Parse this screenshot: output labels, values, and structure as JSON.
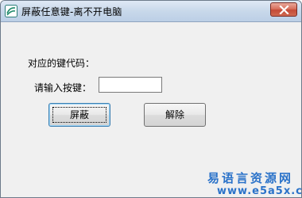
{
  "window": {
    "title": "屏蔽任意键-离不开电脑",
    "icon": "app-logo-icon",
    "close_icon": "close-icon"
  },
  "form": {
    "keycode_label": "对应的键代码：",
    "input_label": "请输入按键：",
    "input_value": ""
  },
  "buttons": {
    "block_label": "屏蔽",
    "release_label": "解除"
  },
  "watermark": {
    "line1": "易语言资源网",
    "line2": "www.e5a5x.com"
  },
  "colors": {
    "titlebar": "#c8d8ea",
    "close_button": "#c44a36",
    "watermark": "#2a72c9",
    "window_bg": "#f0f0f0"
  }
}
